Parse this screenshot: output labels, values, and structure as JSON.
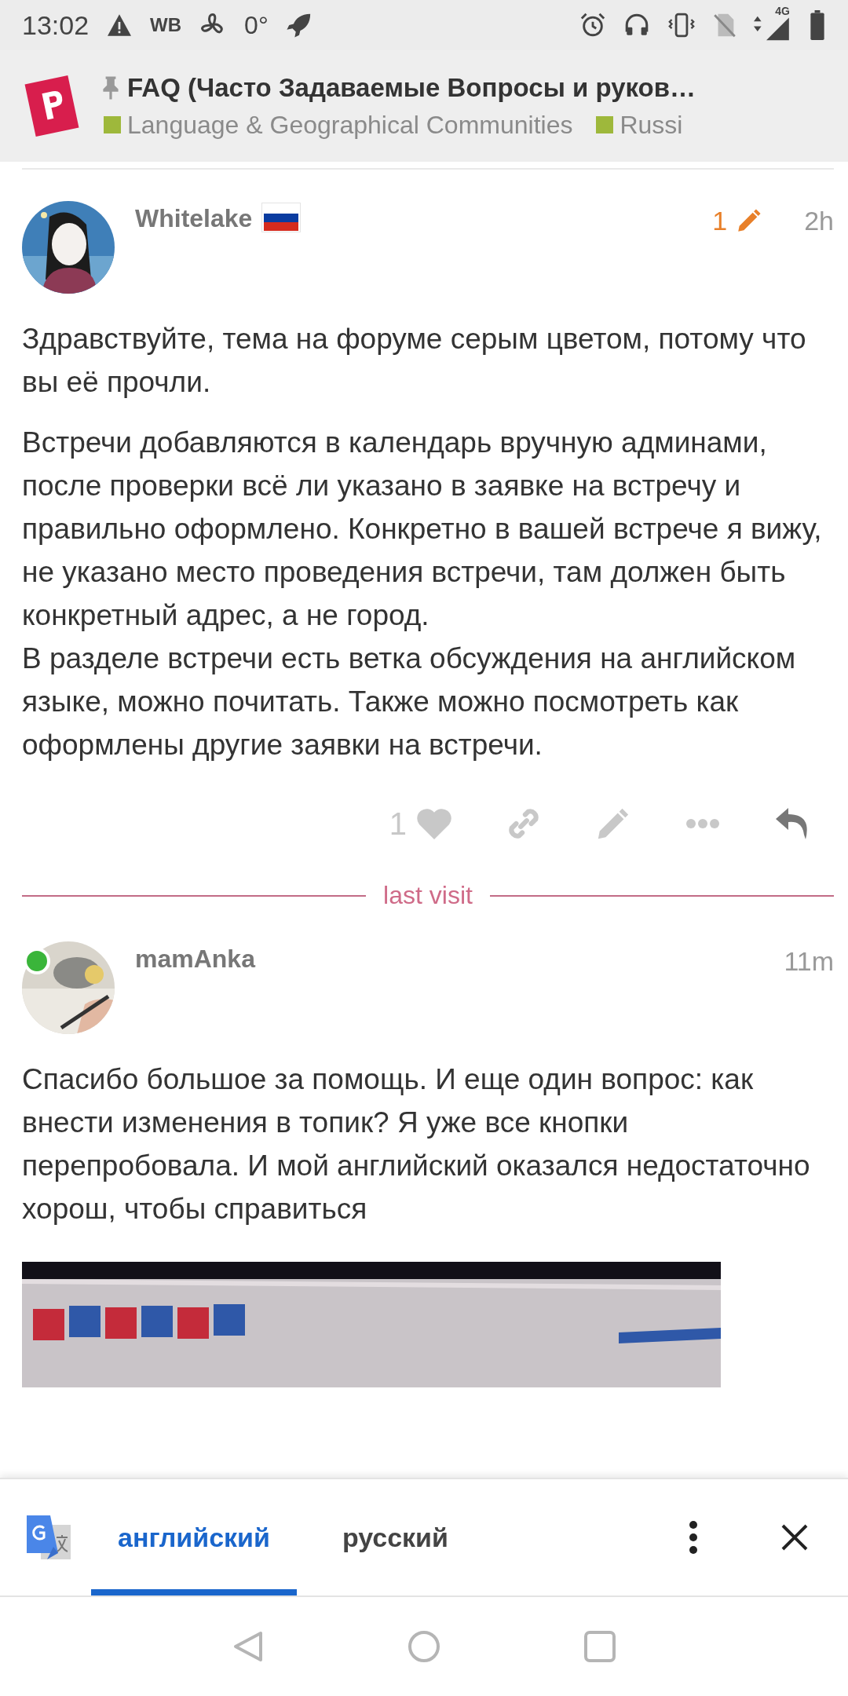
{
  "status_bar": {
    "time": "13:02",
    "carrier": "WB",
    "temperature": "0°",
    "network": "4G"
  },
  "header": {
    "pinned": true,
    "title": "FAQ (Часто Задаваемые Вопросы и руков…",
    "categories": [
      {
        "name": "Language & Geographical Communities",
        "color": "#9eb83b"
      },
      {
        "name": "Russi",
        "color": "#9eb83b"
      }
    ]
  },
  "posts": [
    {
      "username": "Whitelake",
      "flag": true,
      "online": false,
      "edits": "1",
      "time": "2h",
      "paragraphs": [
        "Здравствуйте, тема на форуме серым цветом, потому что вы её прочли.",
        "Встречи добавляются в календарь вручную админами, после проверки всё ли указано в заявке на встречу и правильно оформлено. Конкретно в вашей встрече я вижу, не указано место проведения встречи, там должен быть конкретный адрес, а не город.\nВ разделе встречи есть ветка обсуждения на английском языке, можно почитать. Также можно посмотреть как оформлены другие заявки на встречи."
      ],
      "likes": "1",
      "image": false
    },
    {
      "username": "mamAnka",
      "flag": false,
      "online": true,
      "time": "11m",
      "paragraphs": [
        "Спасибо большое за помощь. И еще один вопрос: как внести изменения в топик? Я уже все кнопки перепробовала. И мой английский оказался недостаточно хорош, чтобы справиться"
      ],
      "image": true
    }
  ],
  "divider": {
    "label": "last visit"
  },
  "translate_bar": {
    "languages": [
      {
        "label": "английский",
        "selected": true
      },
      {
        "label": "русский",
        "selected": false
      }
    ]
  }
}
